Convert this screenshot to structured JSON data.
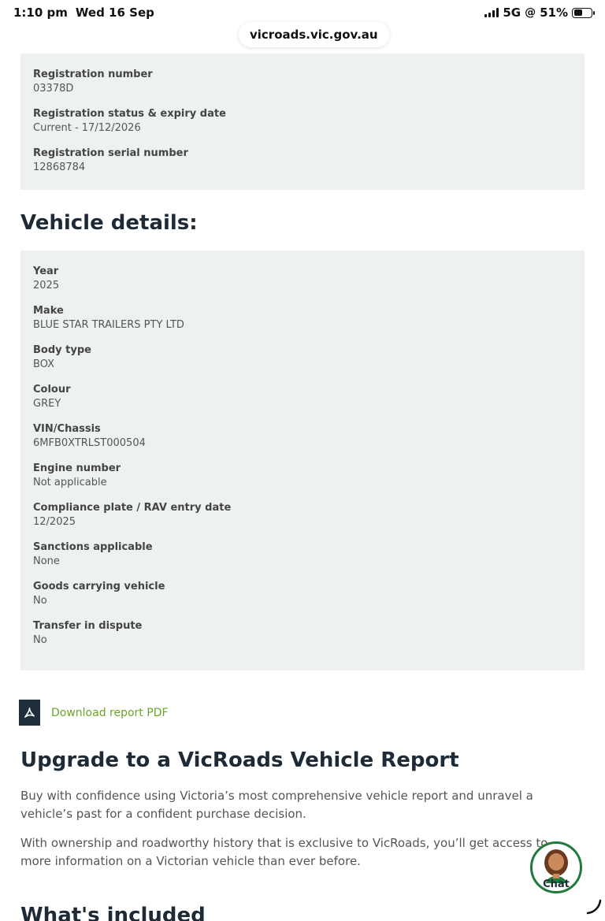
{
  "status_bar": {
    "time": "1:10 pm",
    "date": "Wed 16 Sep",
    "network": "5G",
    "battery_percent": "51%",
    "battery_level": 0.51
  },
  "browser": {
    "url": "vicroads.vic.gov.au"
  },
  "registration_panel": {
    "fields": [
      {
        "label": "Registration number",
        "value": "03378D"
      },
      {
        "label": "Registration status & expiry date",
        "value": "Current - 17/12/2026"
      },
      {
        "label": "Registration serial number",
        "value": "12868784"
      }
    ]
  },
  "vehicle_details": {
    "heading": "Vehicle details:",
    "fields": [
      {
        "label": "Year",
        "value": "2025"
      },
      {
        "label": "Make",
        "value": "BLUE STAR TRAILERS PTY LTD"
      },
      {
        "label": "Body type",
        "value": "BOX"
      },
      {
        "label": "Colour",
        "value": "GREY"
      },
      {
        "label": "VIN/Chassis",
        "value": "6MFB0XTRLST000504"
      },
      {
        "label": "Engine number",
        "value": "Not applicable"
      },
      {
        "label": "Compliance plate / RAV entry date",
        "value": "12/2025"
      },
      {
        "label": "Sanctions applicable",
        "value": "None"
      },
      {
        "label": "Goods carrying vehicle",
        "value": "No"
      },
      {
        "label": "Transfer in dispute",
        "value": "No"
      }
    ]
  },
  "download": {
    "label": "Download report PDF"
  },
  "upgrade": {
    "heading": "Upgrade to a VicRoads Vehicle Report",
    "paragraph1": "Buy with confidence using Victoria’s most comprehensive vehicle report and unravel a vehicle’s past for a confident purchase decision.",
    "paragraph2": "With ownership and roadworthy history that is exclusive to VicRoads, you’ll get access to more information on a Victorian vehicle than ever before."
  },
  "whats_included": {
    "heading": "What's included"
  },
  "chat": {
    "label": "Chat"
  },
  "colors": {
    "panel_bg": "#eef1f1",
    "heading": "#1e2a35",
    "link_green": "#6aa528",
    "pdf_icon_bg": "#1f2d3a",
    "chat_border": "#1f7a3c"
  }
}
